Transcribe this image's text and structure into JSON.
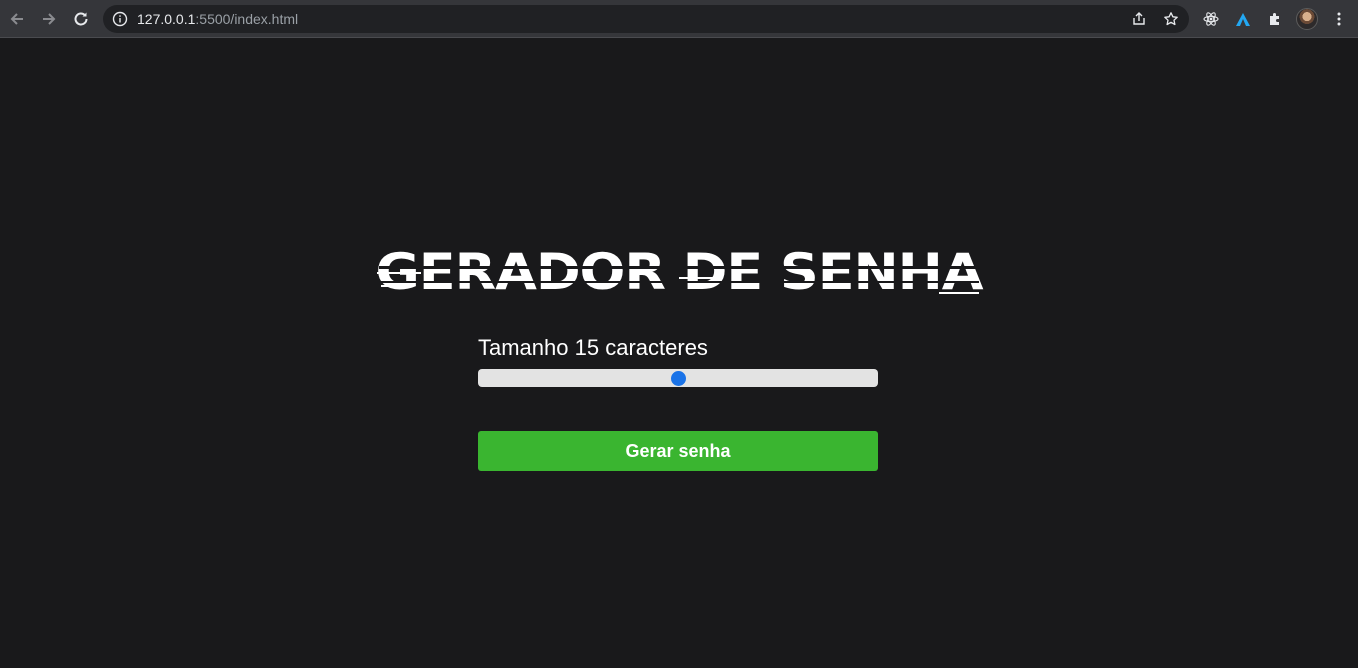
{
  "browser": {
    "url_host": "127.0.0.1",
    "url_rest": ":5500/index.html",
    "icons": {
      "back": "arrow-left-icon",
      "forward": "arrow-right-icon",
      "reload": "reload-icon",
      "info": "info-icon",
      "share": "share-icon",
      "bookmark": "star-icon",
      "react_devtools": "react-icon",
      "extension_2": "arrow-logo-icon",
      "extensions": "puzzle-icon",
      "profile": "avatar",
      "menu": "kebab-menu-icon"
    }
  },
  "page": {
    "title": "GERADOR DE SENHA",
    "size_label_prefix": "Tamanho ",
    "size_value": "15",
    "size_label_suffix": " caracteres",
    "slider": {
      "min": 6,
      "max": 24,
      "value": 15
    },
    "generate_button": "Gerar senha",
    "colors": {
      "background": "#19191b",
      "button": "#3ab530",
      "slider_track": "#e3e3e3",
      "slider_thumb": "#1a73e8"
    }
  }
}
